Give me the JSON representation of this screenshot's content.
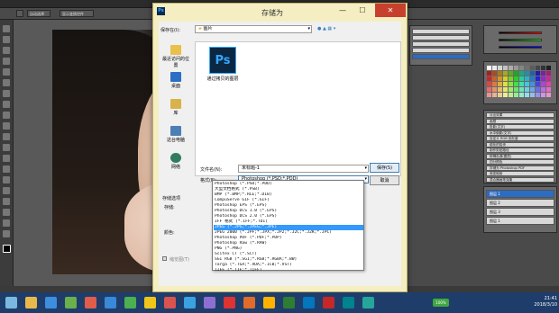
{
  "dialog": {
    "title": "存储为",
    "close_glyph": "✕",
    "min_glyph": "—",
    "max_glyph": "☐",
    "save_in_label": "保存在(I):",
    "save_in_value": "图片",
    "places": [
      {
        "label": "最近访问的位置",
        "icon": "recent-places-icon",
        "color": "#e8c04a"
      },
      {
        "label": "桌面",
        "icon": "desktop-icon",
        "color": "#2a6fc4"
      },
      {
        "label": "库",
        "icon": "library-icon",
        "color": "#d9b24a"
      },
      {
        "label": "这台电脑",
        "icon": "computer-icon",
        "color": "#4c7fb5"
      },
      {
        "label": "网络",
        "icon": "network-icon",
        "color": "#2f7c5e"
      }
    ],
    "file_item_label": "通过拷贝的图层",
    "ps_icon_text": "Ps",
    "filename_label": "文件名(N):",
    "filename_value": "未标题-1",
    "format_label": "格式(F):",
    "format_value": "Photoshop (*.PSD;*.PDD)",
    "save_button": "保存(S)",
    "cancel_button": "取消",
    "options_title": "存储选项",
    "store_label": "存储:",
    "color_label": "颜色:",
    "thumbnail_label": "缩览图(T)",
    "format_options": [
      "Photoshop (*.PSD;*.PDD)",
      "大型文档格式 (*.PSB)",
      "BMP (*.BMP;*.RLE;*.DIB)",
      "CompuServe GIF (*.GIF)",
      "Photoshop EPS (*.EPS)",
      "Photoshop DCS 1.0 (*.EPS)",
      "Photoshop DCS 2.0 (*.EPS)",
      "IFF 格式 (*.IFF;*.TDI)",
      "JPEG (*.JPG;*.JPEG;*.JPE)",
      "JPEG 2000 (*.JPF;*.JPX;*.JP2;*.J2C;*.J2K;*.JPC)",
      "Photoshop PDF (*.PDF;*.PDP)",
      "Photoshop Raw (*.RAW)",
      "PNG (*.PNG)",
      "Scitex CT (*.SCT)",
      "SGI RGB (*.SGI;*.RGB;*.RGBA;*.BW)",
      "Targa (*.TGA;*.VDA;*.ICB;*.VST)",
      "TIFF (*.TIF;*.TIFF)"
    ],
    "selected_option_index": 8
  },
  "photoshop": {
    "opt1": "自动选择",
    "opt2": "显示变换控件",
    "layers": [
      "图层 1",
      "图层 2",
      "图层 3",
      "图层 1"
    ],
    "actions": [
      "淡出效果",
      "画框",
      "投影(文字)",
      "水中倒影(文字)",
      "自定义 RGB 到灰度",
      "熔化的铅块",
      "制作剪贴路径",
      "棕褐色调(图层)",
      "四分颜色",
      "存储为 Photoshop PDF",
      "渐变映射",
      "混合器画笔克隆"
    ]
  },
  "taskbar": {
    "time": "21:41",
    "date": "2018/3/10",
    "battery": "100%",
    "icon_colors": [
      "#7ab8e0",
      "#e9b84b",
      "#3e8ede",
      "#6ab04c",
      "#e15d4b",
      "#3a88d8",
      "#4caf50",
      "#f0c419",
      "#d9534f",
      "#38a3e0",
      "#8e6fd1",
      "#d33",
      "#e06b2b",
      "#ffb300",
      "#2e7d32",
      "#0277bd",
      "#c62828",
      "#00838f",
      "#26a69a"
    ]
  }
}
